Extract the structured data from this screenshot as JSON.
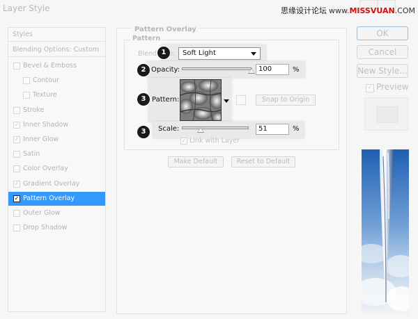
{
  "window": {
    "title": "Layer Style"
  },
  "watermark": {
    "cn": "思缘设计论坛",
    "site_prefix": "www.",
    "site_red": "MISSVUAN",
    "site_suffix": ".COM"
  },
  "styles_panel": {
    "header": "Styles",
    "blending_options": "Blending Options: Custom",
    "items": [
      {
        "label": "Bevel & Emboss",
        "checked": false,
        "indent": 0
      },
      {
        "label": "Contour",
        "checked": false,
        "indent": 1
      },
      {
        "label": "Texture",
        "checked": false,
        "indent": 1
      },
      {
        "label": "Stroke",
        "checked": false,
        "indent": 0
      },
      {
        "label": "Inner Shadow",
        "checked": true,
        "indent": 0
      },
      {
        "label": "Inner Glow",
        "checked": true,
        "indent": 0
      },
      {
        "label": "Satin",
        "checked": false,
        "indent": 0
      },
      {
        "label": "Color Overlay",
        "checked": false,
        "indent": 0
      },
      {
        "label": "Gradient Overlay",
        "checked": true,
        "indent": 0
      },
      {
        "label": "Pattern Overlay",
        "checked": true,
        "indent": 0,
        "selected": true
      },
      {
        "label": "Outer Glow",
        "checked": false,
        "indent": 0
      },
      {
        "label": "Drop Shadow",
        "checked": false,
        "indent": 0
      }
    ]
  },
  "pattern_overlay": {
    "group_title": "Pattern Overlay",
    "subgroup_title": "Pattern",
    "blend_mode_label_visible": "Blend",
    "blend_mode_label_suffix": "e:",
    "blend_mode_value": "Soft Light",
    "opacity_label": "Opacity:",
    "opacity_value": "100",
    "opacity_unit": "%",
    "opacity_fraction": 1.0,
    "pattern_label": "Pattern:",
    "snap_to_origin": "Snap to Origin",
    "scale_label": "Scale:",
    "scale_value": "51",
    "scale_unit": "%",
    "scale_fraction": 0.51,
    "link_with_layer": "Link with Layer",
    "link_checked": true,
    "make_default": "Make Default",
    "reset_to_default": "Reset to Default"
  },
  "callouts": [
    "1",
    "2",
    "3",
    "3"
  ],
  "actions": {
    "ok": "OK",
    "cancel": "Cancel",
    "new_style": "New Style...",
    "preview_label": "Preview",
    "preview_checked": true
  },
  "colors": {
    "selection": "#3399ff",
    "callout_badge": "#1a1a1a",
    "watermark_red": "#d01010"
  }
}
